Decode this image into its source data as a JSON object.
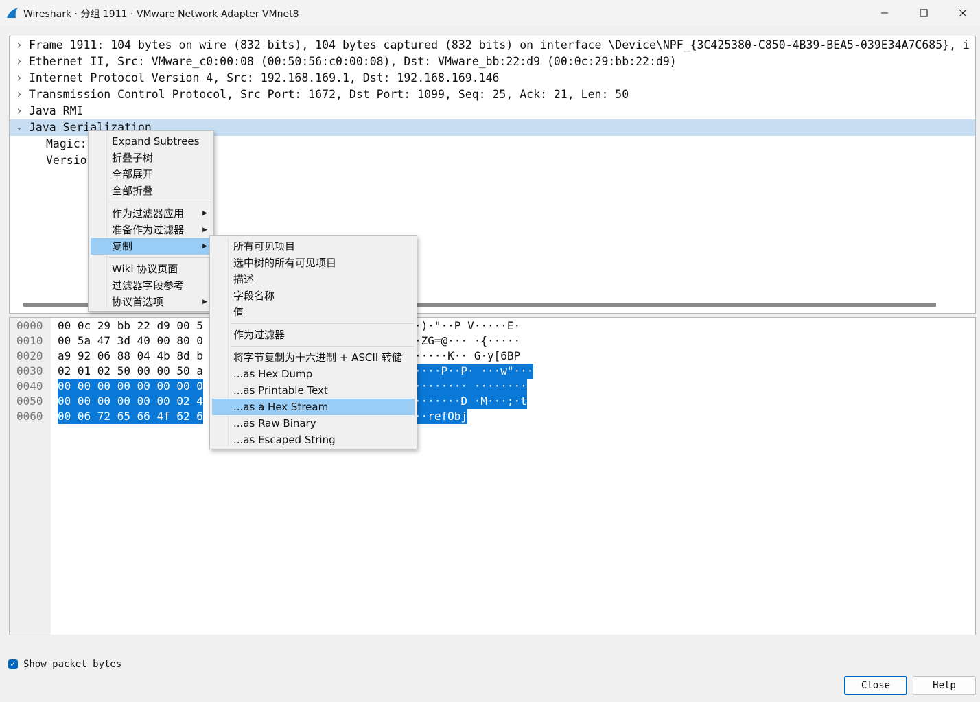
{
  "window": {
    "title": "Wireshark · 分组 1911 · VMware Network Adapter VMnet8",
    "minimize_icon": "minimize-icon",
    "maximize_icon": "maximize-icon",
    "close_icon": "close-icon"
  },
  "tree": {
    "rows": [
      {
        "text": "Frame 1911: 104 bytes on wire (832 bits), 104 bytes captured (832 bits) on interface \\Device\\NPF_{3C425380-C850-4B39-BEA5-039E34A7C685}, i",
        "expanded": false
      },
      {
        "text": "Ethernet II, Src: VMware_c0:00:08 (00:50:56:c0:00:08), Dst: VMware_bb:22:d9 (00:0c:29:bb:22:d9)",
        "expanded": false
      },
      {
        "text": "Internet Protocol Version 4, Src: 192.168.169.1, Dst: 192.168.169.146",
        "expanded": false
      },
      {
        "text": "Transmission Control Protocol, Src Port: 1672, Dst Port: 1099, Seq: 25, Ack: 21, Len: 50",
        "expanded": false
      },
      {
        "text": "Java RMI",
        "expanded": false
      },
      {
        "text": "Java Serialization",
        "expanded": true,
        "selected": true
      }
    ],
    "children": [
      "Magic:",
      "Versio"
    ]
  },
  "bytes": {
    "offsets": [
      "0000",
      "0010",
      "0020",
      "0030",
      "0040",
      "0050",
      "0060"
    ],
    "hex": [
      "00 0c 29 bb 22 d9 00 5",
      "00 5a 47 3d 40 00 80 0",
      "a9 92 06 88 04 4b 8d b",
      "02 01 02 50 00 00 50 a",
      "00 00 00 00 00 00 00 0",
      "00 00 00 00 00 00 02 4",
      "00 06 72 65 66 4f 62 6"
    ],
    "ascii": [
      "·)·\"··P V·····E·",
      "·ZG=@···  ·{·····",
      "·····K·· G·y[6BP",
      "····P··P· ···w\"···",
      "········ ········",
      "·······D ·M···;·t",
      "··refObj"
    ]
  },
  "show_packet_bytes": {
    "label": "Show packet bytes",
    "checked": true
  },
  "buttons": {
    "close": "Close",
    "help": "Help"
  },
  "context_menu": {
    "groups": [
      [
        "Expand Subtrees",
        "折叠子树",
        "全部展开",
        "全部折叠"
      ],
      [
        "作为过滤器应用",
        "准备作为过滤器",
        "复制"
      ],
      [
        "Wiki 协议页面",
        "过滤器字段参考",
        "协议首选项"
      ]
    ],
    "submenu_items": [
      "作为过滤器应用",
      "准备作为过滤器",
      "复制",
      "协议首选项"
    ],
    "active_item": "复制"
  },
  "copy_submenu": {
    "groups": [
      [
        "所有可见项目",
        "选中树的所有可见项目",
        "描述",
        "字段名称",
        "值"
      ],
      [
        "作为过滤器"
      ],
      [
        "将字节复制为十六进制 + ASCII 转储",
        "...as Hex Dump",
        "...as Printable Text",
        "...as a Hex Stream",
        "...as Raw Binary",
        "...as Escaped String"
      ]
    ],
    "active_item": "...as a Hex Stream"
  },
  "colors": {
    "selection": "#0a78d7",
    "tree_selection": "#c8dff3",
    "menu_active": "#99cdf5",
    "accent": "#0067c0"
  }
}
